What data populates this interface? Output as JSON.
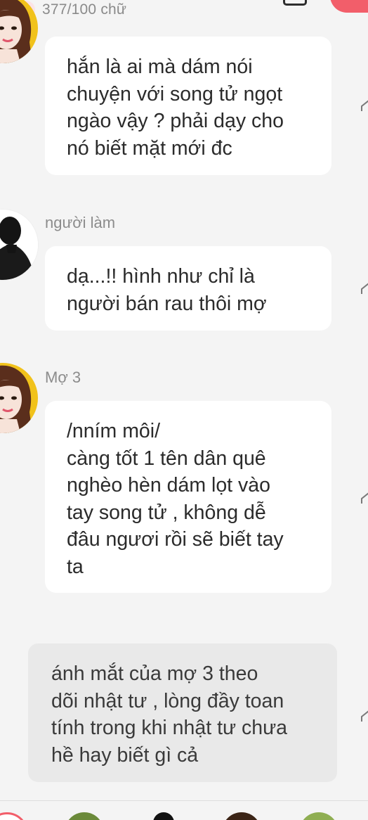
{
  "header": {
    "word_count": "377/100 chữ",
    "icons": [
      "pencil-icon",
      "bookmark-icon"
    ],
    "colors": {
      "accent": "#f25e6a"
    }
  },
  "messages": [
    {
      "speaker": "",
      "avatar": "woman-portrait",
      "lines": [
        "hắn là ai mà dám nói",
        "chuyện với song tử ngọt",
        "ngào vậy ? phải dạy cho",
        "nó biết mặt mới đc"
      ]
    },
    {
      "speaker": "người làm",
      "avatar": "silhouette",
      "lines": [
        "dạ...!! hình như chỉ là",
        "người bán rau thôi mợ"
      ]
    },
    {
      "speaker": "Mợ 3",
      "avatar": "woman-portrait",
      "lines": [
        "/nním môi/",
        "càng tốt 1 tên dân quê",
        "nghèo hèn dám lọt vào",
        "tay song tử , không dễ",
        "đâu ngươi rồi sẽ biết tay",
        "ta"
      ]
    }
  ],
  "narration": {
    "lines": [
      "ánh mắt của mợ 3 theo",
      "dõi nhật tư , lòng đầy toan",
      "tính trong khi nhật tư chưa",
      "hề hay biết gì cả"
    ]
  },
  "bottom_bar": {
    "avatars": [
      "add-character",
      "character-2",
      "character-3",
      "character-4",
      "character-5"
    ]
  }
}
